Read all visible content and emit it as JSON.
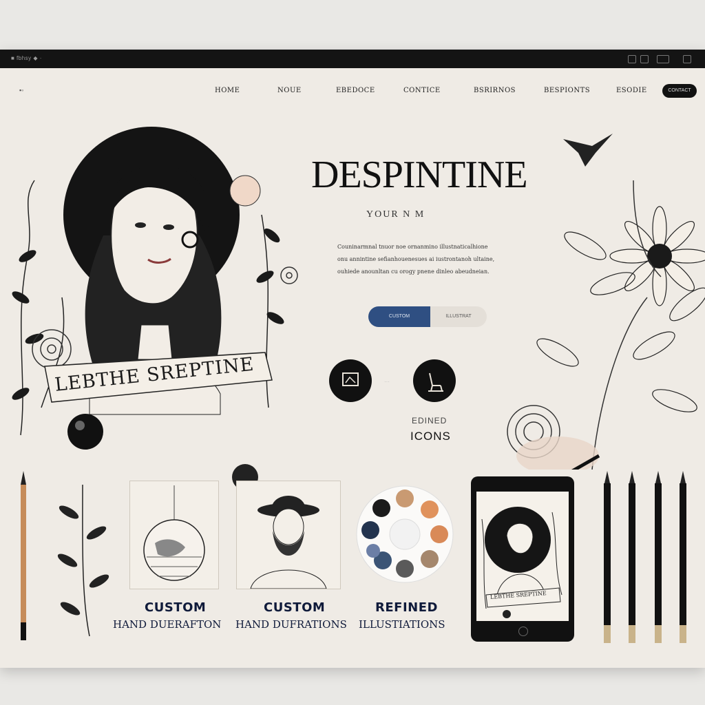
{
  "window": {
    "title": "■ fbhsy ◆ ·"
  },
  "nav": {
    "items": [
      "HOME",
      "NOUE",
      "EBEDOCE",
      "CONTICE",
      "BSRIRNOS",
      "BESPIONTS",
      "ESODIE"
    ],
    "cta": "CONTACT"
  },
  "hero": {
    "title": "DESPINTINE",
    "subtitle": "YOUR         N M",
    "banner_text": "LEBTHE SREPTINE",
    "description": [
      "Couninarmnal tnuor noe ornanmino illustnaticalhione",
      "onu annintine sefianhouenesues ai iustrontanoh ultaine,",
      "ouhiede anounltan cu orogy pnene dinleo abeudneian."
    ],
    "primary_button": "CUSTOM",
    "secondary_button": "ILLUSTRAT"
  },
  "icons_section": {
    "small_label": "EDINED",
    "label": "ICONS"
  },
  "cards": [
    {
      "title": "CUSTOM",
      "caption": "HAND DUERAFTON"
    },
    {
      "title": "CUSTOM",
      "caption": "HAND DUFRATIONS"
    },
    {
      "title": "REFINED",
      "caption": "ILLUSTIATIONS"
    }
  ],
  "tablet": {
    "banner_text": "LEBTHE SREPTINE"
  },
  "colors": {
    "accent": "#2f4f82",
    "ink": "#111111",
    "paper": "#efebe5",
    "palette_swatches": [
      "#c99a72",
      "#e0925c",
      "#d98a58",
      "#a5876c",
      "#5a5a5a",
      "#3b5475",
      "#6c7fa6",
      "#23344e",
      "#1b1b1b"
    ]
  }
}
